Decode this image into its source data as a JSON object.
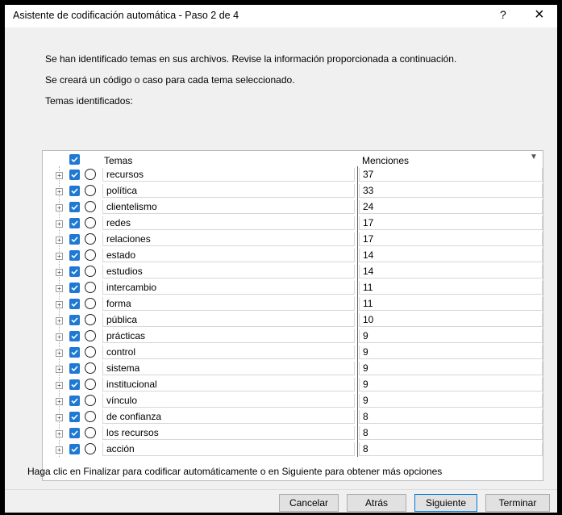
{
  "window": {
    "title": "Asistente de codificación automática - Paso 2 de 4",
    "help_label": "?",
    "close_label": "×"
  },
  "info": {
    "line1": "Se han identificado temas en sus archivos. Revise la información proporcionada a continuación.",
    "line2": "Se creará un código o caso para cada tema seleccionado.",
    "line3": "Temas identificados:"
  },
  "table": {
    "headers": {
      "themes": "Temas",
      "mentions": "Menciones"
    },
    "rows": [
      {
        "theme": "recursos",
        "mentions": "37"
      },
      {
        "theme": "política",
        "mentions": "33"
      },
      {
        "theme": "clientelismo",
        "mentions": "24"
      },
      {
        "theme": "redes",
        "mentions": "17"
      },
      {
        "theme": "relaciones",
        "mentions": "17"
      },
      {
        "theme": "estado",
        "mentions": "14"
      },
      {
        "theme": "estudios",
        "mentions": "14"
      },
      {
        "theme": "intercambio",
        "mentions": "11"
      },
      {
        "theme": "forma",
        "mentions": "11"
      },
      {
        "theme": "pública",
        "mentions": "10"
      },
      {
        "theme": "prácticas",
        "mentions": "9"
      },
      {
        "theme": "control",
        "mentions": "9"
      },
      {
        "theme": "sistema",
        "mentions": "9"
      },
      {
        "theme": "institucional",
        "mentions": "9"
      },
      {
        "theme": "vínculo",
        "mentions": "9"
      },
      {
        "theme": "de confianza",
        "mentions": "8"
      },
      {
        "theme": "los recursos",
        "mentions": "8"
      },
      {
        "theme": "acción",
        "mentions": "8"
      }
    ]
  },
  "status": "Haga clic en Finalizar para codificar automáticamente o en Siguiente para obtener más opciones",
  "buttons": {
    "cancel": "Cancelar",
    "back": "Atrás",
    "next": "Siguiente",
    "finish": "Terminar"
  },
  "colors": {
    "checkbox": "#1f78d1",
    "primary_border": "#0078d7"
  }
}
